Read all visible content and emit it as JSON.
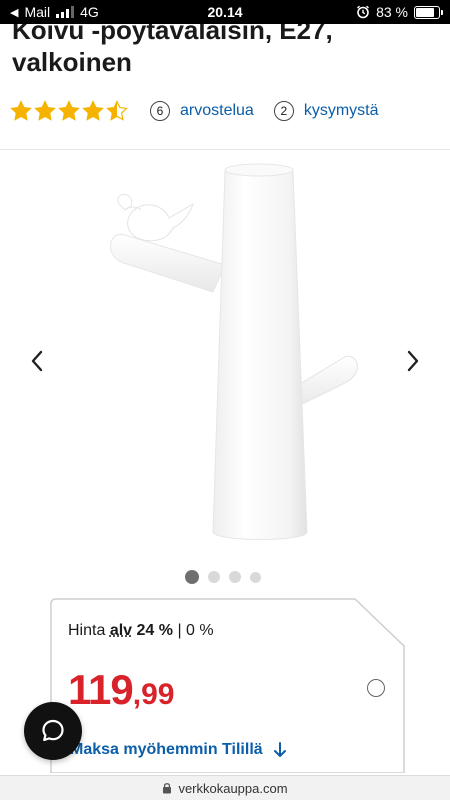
{
  "status_bar": {
    "back_app": "Mail",
    "network": "4G",
    "time": "20.14",
    "battery": "83 %",
    "battery_level": 0.83
  },
  "product": {
    "title": "Koivu -pöytävalaisin, E27, valkoinen",
    "rating": 4.5,
    "review_count": "6",
    "review_label": "arvostelua",
    "question_count": "2",
    "question_label": "kysymystä"
  },
  "gallery": {
    "image_count": 4,
    "active_index": 0
  },
  "price": {
    "label_prefix": "Hinta",
    "alv_label": "alv",
    "vat_selected": "24 %",
    "separator": "|",
    "vat_other": "0 %",
    "integer": "119",
    "decimal": ",99",
    "pay_later": "Maksa myöhemmin Tilillä"
  },
  "browser": {
    "url": "verkkokauppa.com"
  },
  "colors": {
    "price_red": "#d8232a",
    "link_blue": "#0b5ea8",
    "star_gold": "#f5b300"
  }
}
